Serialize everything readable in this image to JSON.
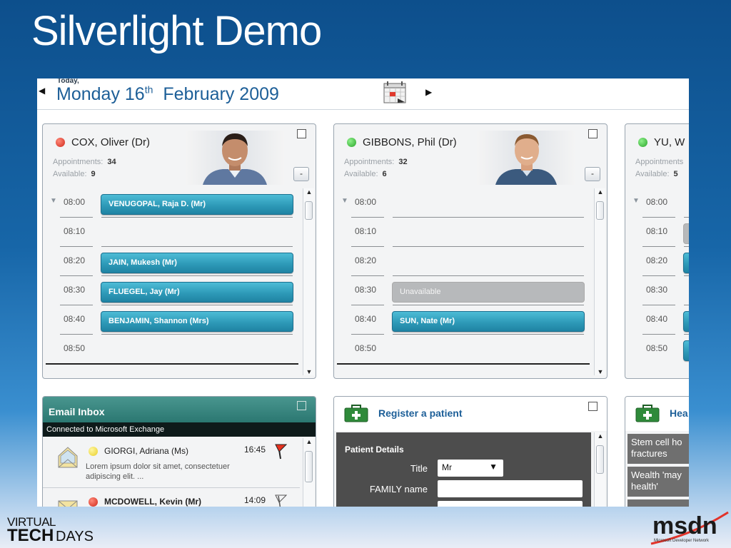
{
  "slide": {
    "title": "Silverlight Demo"
  },
  "datebar": {
    "today_label": "Today,",
    "day_name": "Monday",
    "day_number": "16",
    "ordinal": "th",
    "month_year": "February 2009"
  },
  "doctors": [
    {
      "name": "COX, Oliver (Dr)",
      "status": "red",
      "appointments_label": "Appointments:",
      "appointments": "34",
      "available_label": "Available:",
      "available": "9",
      "collapse_label": "-",
      "slots": [
        {
          "time": "08:00",
          "patient": "VENUGOPAL, Raja D. (Mr)",
          "kind": "booked",
          "expanded": true
        },
        {
          "time": "08:10",
          "patient": "",
          "kind": "free"
        },
        {
          "time": "08:20",
          "patient": "JAIN, Mukesh (Mr)",
          "kind": "booked"
        },
        {
          "time": "08:30",
          "patient": "FLUEGEL, Jay (Mr)",
          "kind": "booked"
        },
        {
          "time": "08:40",
          "patient": "BENJAMIN, Shannon (Mrs)",
          "kind": "booked"
        },
        {
          "time": "08:50",
          "patient": "",
          "kind": "free"
        }
      ]
    },
    {
      "name": "GIBBONS, Phil (Dr)",
      "status": "green",
      "appointments_label": "Appointments:",
      "appointments": "32",
      "available_label": "Available:",
      "available": "6",
      "collapse_label": "-",
      "slots": [
        {
          "time": "08:00",
          "patient": "",
          "kind": "free",
          "expanded": true
        },
        {
          "time": "08:10",
          "patient": "",
          "kind": "free"
        },
        {
          "time": "08:20",
          "patient": "",
          "kind": "free"
        },
        {
          "time": "08:30",
          "patient": "Unavailable",
          "kind": "unavailable"
        },
        {
          "time": "08:40",
          "patient": "SUN, Nate (Mr)",
          "kind": "booked"
        },
        {
          "time": "08:50",
          "patient": "",
          "kind": "free"
        }
      ]
    },
    {
      "name": "YU, W",
      "status": "green",
      "appointments_label": "Appointments",
      "appointments": "",
      "available_label": "Available:",
      "available": "5",
      "collapse_label": "",
      "slots": [
        {
          "time": "08:00",
          "patient": "",
          "kind": "free",
          "expanded": true
        },
        {
          "time": "08:10",
          "patient": "",
          "kind": "unavailable"
        },
        {
          "time": "08:20",
          "patient": "",
          "kind": "booked"
        },
        {
          "time": "08:30",
          "patient": "",
          "kind": "free"
        },
        {
          "time": "08:40",
          "patient": "",
          "kind": "booked"
        },
        {
          "time": "08:50",
          "patient": "",
          "kind": "booked"
        }
      ]
    }
  ],
  "inbox": {
    "title": "Email Inbox",
    "connection": "Connected to Microsoft Exchange",
    "messages": [
      {
        "from": "GIORGI, Adriana (Ms)",
        "time": "16:45",
        "preview": "Lorem ipsum dolor sit amet, consectetuer adipiscing elit. ...",
        "status": "yellow",
        "flagged": true,
        "read": true
      },
      {
        "from": "MCDOWELL, Kevin (Mr)",
        "time": "14:09",
        "preview": "",
        "status": "red",
        "flagged": false,
        "read": false
      }
    ]
  },
  "register": {
    "title": "Register a patient",
    "section": "Patient Details",
    "title_label": "Title",
    "title_value": "Mr",
    "family_label": "FAMILY name"
  },
  "news": {
    "title": "Hea",
    "items": [
      "Stem cell ho fractures",
      "Wealth 'may health'"
    ]
  },
  "colors": {
    "accent": "#1d5f98",
    "appointment": "#2e9ab8",
    "inbox_header": "#2b7771",
    "status_red": "#d0281a",
    "status_green": "#2aa52a"
  }
}
